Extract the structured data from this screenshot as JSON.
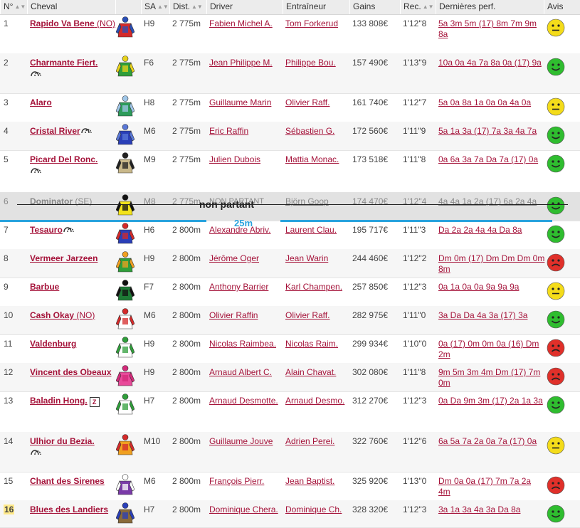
{
  "header": {
    "num": "N°",
    "cheval": "Cheval",
    "sa": "SA",
    "dist": "Dist.",
    "driver": "Driver",
    "entraineur": "Entraîneur",
    "gains": "Gains",
    "rec": "Rec.",
    "perf": "Dernières perf.",
    "avis": "Avis"
  },
  "non_partant_label": "non partant",
  "gap_label": "25m",
  "rows": [
    {
      "num": "1",
      "name": "Rapido Va Bene",
      "tag": "(NO)",
      "sa": "H9",
      "dist": "2 775m",
      "driver": "Fabien Michel A.",
      "trainer": "Tom Forkerud",
      "gains": "133 808€",
      "rec": "1'12\"8",
      "perf": "5a 3m 5m (17) 8m 7m 9m 8a",
      "avis": "neutral",
      "silk": [
        "#d42a2a",
        "#2a4fb8"
      ]
    },
    {
      "num": "2",
      "name": "Charmante Fiert.",
      "tag": "",
      "sa": "F6",
      "dist": "2 775m",
      "driver": "Jean Philippe M.",
      "trainer": "Philippe Bou.",
      "gains": "157 490€",
      "rec": "1'13\"9",
      "perf": "10a 0a 4a 7a 8a 0a (17) 9a",
      "avis": "good",
      "silk": [
        "#2f9e3a",
        "#e8d21a"
      ]
    },
    {
      "num": "3",
      "name": "Alaro",
      "tag": "",
      "sa": "H8",
      "dist": "2 775m",
      "driver": "Guillaume Marin",
      "trainer": "Olivier Raff.",
      "gains": "161 740€",
      "rec": "1'12\"7",
      "perf": "5a 0a 8a 1a 0a 0a 4a 0a",
      "avis": "neutral",
      "silk": [
        "#2d9b5a",
        "#9fc6e8"
      ]
    },
    {
      "num": "4",
      "name": "Cristal River",
      "tag": "",
      "sa": "M6",
      "dist": "2 775m",
      "driver": "Eric Raffin",
      "trainer": "Sébastien G.",
      "gains": "172 560€",
      "rec": "1'11\"9",
      "perf": "5a 1a 3a (17) 7a 3a 4a 7a",
      "avis": "good",
      "silk": [
        "#2a3fb8",
        "#5a78d8"
      ]
    },
    {
      "num": "5",
      "name": "Picard Del Ronc.",
      "tag": "",
      "sa": "M9",
      "dist": "2 775m",
      "driver": "Julien Dubois",
      "trainer": "Mattia Monac.",
      "gains": "173 518€",
      "rec": "1'11\"8",
      "perf": "0a 6a 3a 7a Da 7a (17) 0a",
      "avis": "good",
      "silk": [
        "#c9b88a",
        "#222222"
      ]
    },
    {
      "num": "6",
      "name": "Dominator",
      "tag": "(SE)",
      "sa": "M8",
      "dist": "2 775m",
      "driver": "NON PARTANT",
      "trainer": "Björn Goop",
      "gains": "174 470€",
      "rec": "1'12\"4",
      "perf": "4a 4a 1a 2a (17) 6a 2a 4a",
      "avis": "good",
      "silk": [
        "#f2e21a",
        "#111111"
      ]
    },
    {
      "num": "7",
      "name": "Tesauro",
      "tag": "",
      "sa": "H6",
      "dist": "2 800m",
      "driver": "Alexandre Abriv.",
      "trainer": "Laurent Clau.",
      "gains": "195 717€",
      "rec": "1'11\"3",
      "perf": "Da 2a 2a 4a 4a Da 8a",
      "avis": "good",
      "silk": [
        "#2a3fb8",
        "#d42a2a"
      ]
    },
    {
      "num": "8",
      "name": "Vermeer Jarzeen",
      "tag": "",
      "sa": "H9",
      "dist": "2 800m",
      "driver": "Jérôme Oger",
      "trainer": "Jean Warin",
      "gains": "244 460€",
      "rec": "1'12\"2",
      "perf": "Dm 0m (17) Dm Dm Dm 0m 8m",
      "avis": "bad",
      "silk": [
        "#2f9e3a",
        "#f0a020"
      ]
    },
    {
      "num": "9",
      "name": "Barbue",
      "tag": "",
      "sa": "F7",
      "dist": "2 800m",
      "driver": "Anthony Barrier",
      "trainer": "Karl Champen.",
      "gains": "257 850€",
      "rec": "1'12\"3",
      "perf": "0a 1a 0a 0a 9a 9a 9a",
      "avis": "neutral",
      "silk": [
        "#1d7a35",
        "#111111"
      ]
    },
    {
      "num": "10",
      "name": "Cash Okay",
      "tag": "(NO)",
      "sa": "M6",
      "dist": "2 800m",
      "driver": "Olivier Raffin",
      "trainer": "Olivier Raff.",
      "gains": "282 975€",
      "rec": "1'11\"0",
      "perf": "3a Da Da 4a 3a (17) 3a",
      "avis": "good",
      "silk": [
        "#ffffff",
        "#d42a2a"
      ]
    },
    {
      "num": "11",
      "name": "Valdenburg",
      "tag": "",
      "sa": "H9",
      "dist": "2 800m",
      "driver": "Nicolas Raimbea.",
      "trainer": "Nicolas Raim.",
      "gains": "299 934€",
      "rec": "1'10\"0",
      "perf": "0a (17) 0m 0m 0a (16) Dm 2m",
      "avis": "bad",
      "silk": [
        "#ffffff",
        "#2f9e3a"
      ]
    },
    {
      "num": "12",
      "name": "Vincent des Obeaux",
      "tag": "",
      "sa": "H9",
      "dist": "2 800m",
      "driver": "Arnaud Albert C.",
      "trainer": "Alain Chavat.",
      "gains": "302 080€",
      "rec": "1'11\"8",
      "perf": "9m 5m 3m 4m Dm (17) 7m 0m",
      "avis": "bad",
      "silk": [
        "#e84a9a",
        "#d42a7a"
      ]
    },
    {
      "num": "13",
      "name": "Baladin Hong.",
      "tag": "",
      "sa": "H7",
      "dist": "2 800m",
      "driver": "Arnaud Desmotte.",
      "trainer": "Arnaud Desmo.",
      "gains": "312 270€",
      "rec": "1'12\"3",
      "perf": "0a Da 9m 3m (17) 2a 1a 3a",
      "avis": "good",
      "silk": [
        "#ffffff",
        "#2f9e3a"
      ]
    },
    {
      "num": "14",
      "name": "Ulhior du Bezia.",
      "tag": "",
      "sa": "M10",
      "dist": "2 800m",
      "driver": "Guillaume Jouve",
      "trainer": "Adrien Perei.",
      "gains": "322 760€",
      "rec": "1'12\"6",
      "perf": "6a 5a 7a 2a 0a 7a (17) 0a",
      "avis": "neutral",
      "silk": [
        "#f0a020",
        "#d42a2a"
      ]
    },
    {
      "num": "15",
      "name": "Chant des Sirenes",
      "tag": "",
      "sa": "M6",
      "dist": "2 800m",
      "driver": "François Pierr.",
      "trainer": "Jean Baptist.",
      "gains": "325 920€",
      "rec": "1'13\"0",
      "perf": "Dm 0a 0a (17) 7m 7a 2a 4m",
      "avis": "bad",
      "silk": [
        "#7a3aa8",
        "#ffffff"
      ]
    },
    {
      "num": "16",
      "name": "Blues des Landiers",
      "tag": "",
      "sa": "H7",
      "dist": "2 800m",
      "driver": "Dominique Chera.",
      "trainer": "Dominique Ch.",
      "gains": "328 320€",
      "rec": "1'12\"3",
      "perf": "3a 1a 3a 4a 3a Da 8a",
      "avis": "good",
      "silk": [
        "#8a6a3a",
        "#2a3fb8"
      ]
    }
  ],
  "colors": {
    "link": "#a5133a",
    "good": "#2fbd2f",
    "neutral": "#f4dc1a",
    "bad": "#e0302a",
    "gap": "#29a3dd"
  }
}
